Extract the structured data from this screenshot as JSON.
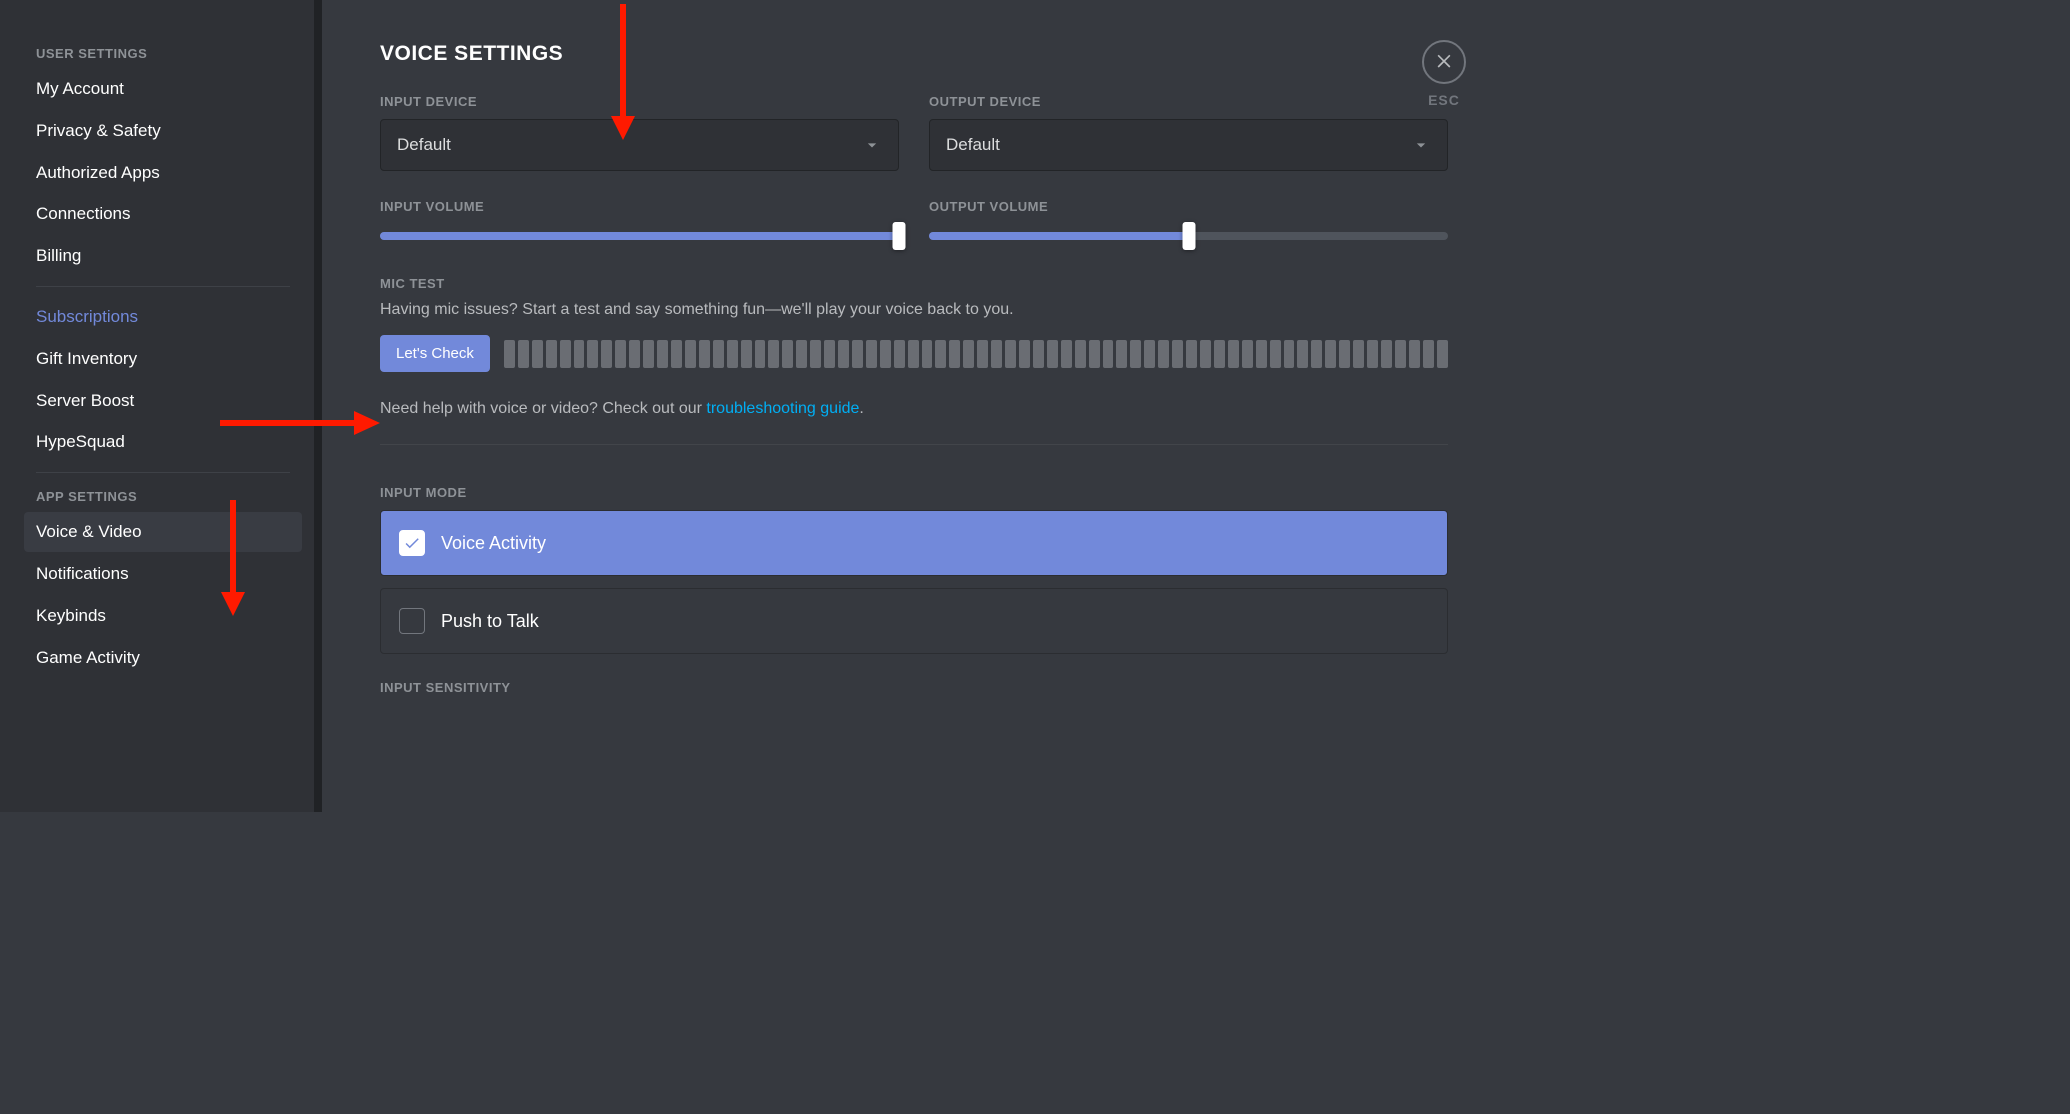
{
  "sidebar": {
    "section1": "USER SETTINGS",
    "items1": {
      "my_account": "My Account",
      "privacy": "Privacy & Safety",
      "authorized_apps": "Authorized Apps",
      "connections": "Connections",
      "billing": "Billing",
      "subscriptions": "Subscriptions",
      "gift_inventory": "Gift Inventory",
      "server_boost": "Server Boost",
      "hypesquad": "HypeSquad"
    },
    "section2": "APP SETTINGS",
    "items2": {
      "voice_video": "Voice & Video",
      "notifications": "Notifications",
      "keybinds": "Keybinds",
      "game_activity": "Game Activity"
    }
  },
  "close": {
    "esc": "ESC"
  },
  "main": {
    "title": "VOICE SETTINGS",
    "input_device_label": "INPUT DEVICE",
    "input_device_value": "Default",
    "output_device_label": "OUTPUT DEVICE",
    "output_device_value": "Default",
    "input_volume_label": "INPUT VOLUME",
    "output_volume_label": "OUTPUT VOLUME",
    "input_volume_pct": 100,
    "output_volume_pct": 50,
    "mic_test_label": "MIC TEST",
    "mic_test_desc": "Having mic issues? Start a test and say something fun—we'll play your voice back to you.",
    "lets_check": "Let's Check",
    "help_prefix": "Need help with voice or video? Check out our ",
    "help_link": "troubleshooting guide",
    "help_suffix": ".",
    "input_mode_label": "INPUT MODE",
    "voice_activity": "Voice Activity",
    "push_to_talk": "Push to Talk",
    "input_sensitivity_label": "INPUT SENSITIVITY"
  },
  "colors": {
    "accent": "#7289da",
    "annotation": "#ff1a00"
  }
}
